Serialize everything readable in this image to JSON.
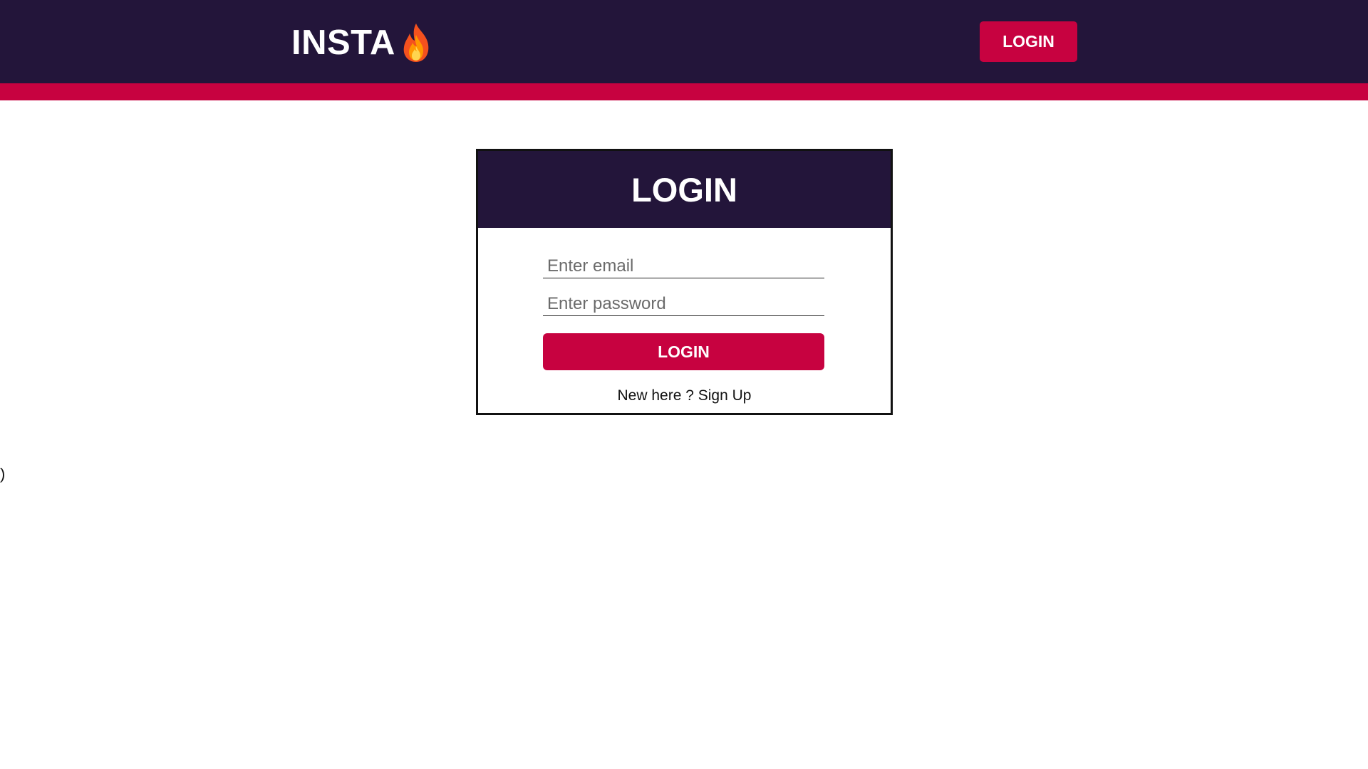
{
  "header": {
    "brand_text": "INSTA",
    "brand_icon": "fire-icon",
    "login_button_label": "LOGIN"
  },
  "login_card": {
    "title": "LOGIN",
    "email_placeholder": "Enter email",
    "password_placeholder": "Enter password",
    "submit_label": "LOGIN",
    "signup_prefix": "New here ?",
    "signup_link_label": "Sign Up"
  },
  "stray_text": ")",
  "colors": {
    "header_background": "#23153a",
    "accent": "#c70240",
    "background": "#ffffff"
  }
}
